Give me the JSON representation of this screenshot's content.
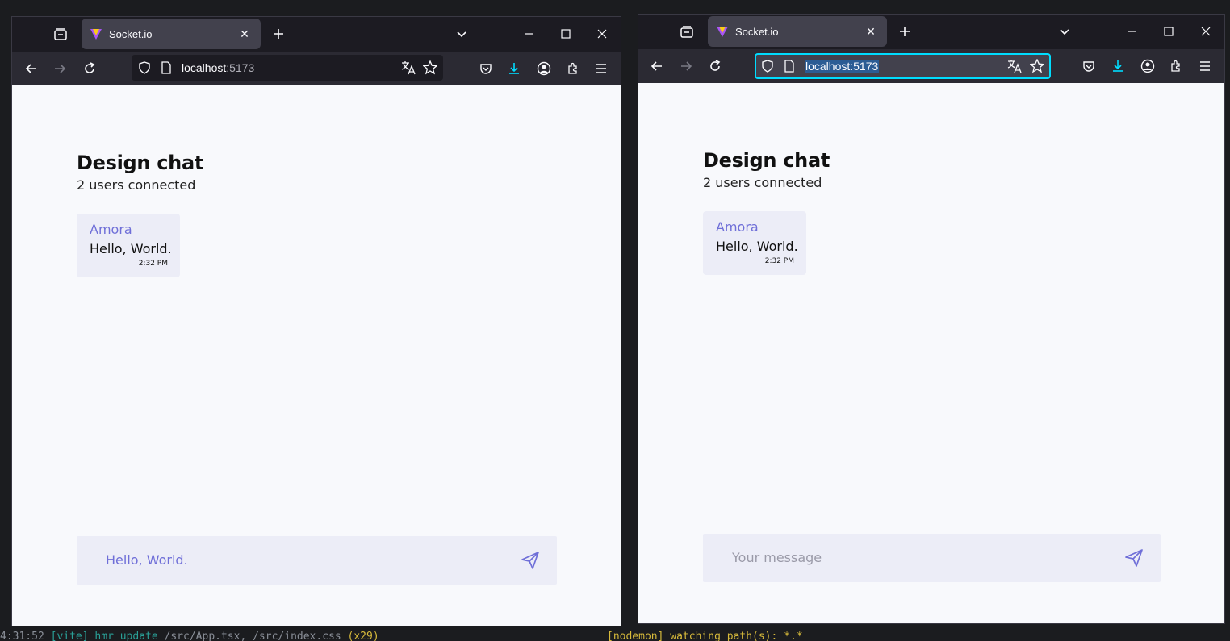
{
  "terminal": {
    "left_time": "4:31:52",
    "left_tag": "[vite]",
    "left_action": "hmr update",
    "left_files": "/src/App.tsx, /src/index.css",
    "left_count": "(x29)",
    "right_tag": "[nodemon]",
    "right_text": "watching path(s): *.*"
  },
  "windows": [
    {
      "tab_title": "Socket.io",
      "url_host": "localhost",
      "url_port": ":5173",
      "chat": {
        "title": "Design chat",
        "users": "2 users connected",
        "messages": [
          {
            "author": "Amora",
            "text": "Hello, World.",
            "time": "2:32 PM"
          }
        ],
        "input_value": "Hello, World.",
        "input_placeholder": "Your message"
      }
    },
    {
      "tab_title": "Socket.io",
      "url_full": "localhost:5173",
      "chat": {
        "title": "Design chat",
        "users": "2 users connected",
        "messages": [
          {
            "author": "Amora",
            "text": "Hello, World.",
            "time": "2:32 PM"
          }
        ],
        "input_value": "",
        "input_placeholder": "Your message"
      }
    }
  ],
  "colors": {
    "accent": "#6f6fd8",
    "browser_chrome": "#1c1b22",
    "toolbar": "#2b2a33",
    "page_bg": "#f8f9fc",
    "bubble_bg": "#ecedf7",
    "focus_ring": "#00ddff"
  }
}
